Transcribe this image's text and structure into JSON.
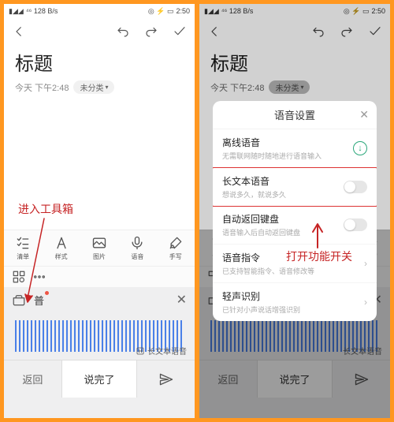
{
  "status": {
    "time": "2:50",
    "net": "⁴⁶ 128 B/s"
  },
  "title": "标题",
  "meta": {
    "time": "今天 下午2:48",
    "cat": "未分类"
  },
  "anno": {
    "left": "进入工具箱",
    "right": "打开功能开关"
  },
  "tools": [
    {
      "k": "list",
      "label": "清单"
    },
    {
      "k": "style",
      "label": "样式"
    },
    {
      "k": "image",
      "label": "图片"
    },
    {
      "k": "voice",
      "label": "语音"
    },
    {
      "k": "hand",
      "label": "手写"
    }
  ],
  "ime": {
    "pu": "普",
    "tag": "长文本语音",
    "done": "说完了",
    "back": "返回"
  },
  "modal": {
    "title": "语音设置",
    "rows": [
      {
        "t1": "离线语音",
        "t2": "无需联网随时随地进行语音输入",
        "kind": "dl"
      },
      {
        "t1": "长文本语音",
        "t2": "想说多久，就说多久",
        "kind": "sw",
        "hl": true
      },
      {
        "t1": "自动返回键盘",
        "t2": "语音输入后自动返回键盘",
        "kind": "sw"
      },
      {
        "t1": "语音指令",
        "t2": "已支持智能指令、语音修改等",
        "kind": "chev"
      },
      {
        "t1": "轻声识别",
        "t2": "已针对小声说话增强识别",
        "kind": "chev"
      }
    ]
  }
}
